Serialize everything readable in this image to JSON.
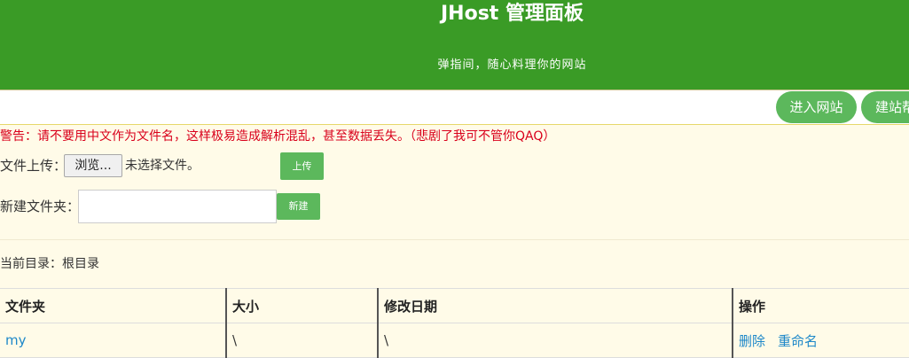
{
  "header": {
    "title": "JHost 管理面板",
    "subtitle": "弹指间，随心料理你的网站"
  },
  "nav": {
    "enter_site": "进入网站",
    "build_site": "建站帮"
  },
  "warning": "警告：请不要用中文作为文件名，这样极易造成解析混乱，甚至数据丢失。（悲剧了我可不管你QAQ）",
  "upload": {
    "label": "文件上传：",
    "browse": "浏览...",
    "no_file": "未选择文件。",
    "button": "上传"
  },
  "new_folder": {
    "label": "新建文件夹：",
    "input_value": "",
    "button": "新建"
  },
  "current_dir": "当前目录：根目录",
  "table": {
    "headers": [
      "文件夹",
      "大小",
      "修改日期",
      "操作"
    ],
    "rows": [
      {
        "name": "my",
        "size": "\\",
        "date": "\\",
        "actions": [
          "删除",
          "重命名"
        ]
      }
    ]
  },
  "colors": {
    "header_bg": "#3a9b26",
    "button_green": "#5cb85c",
    "page_bg": "#fffbe8",
    "warning_red": "#d9001b",
    "link_blue": "#1e88c9"
  }
}
